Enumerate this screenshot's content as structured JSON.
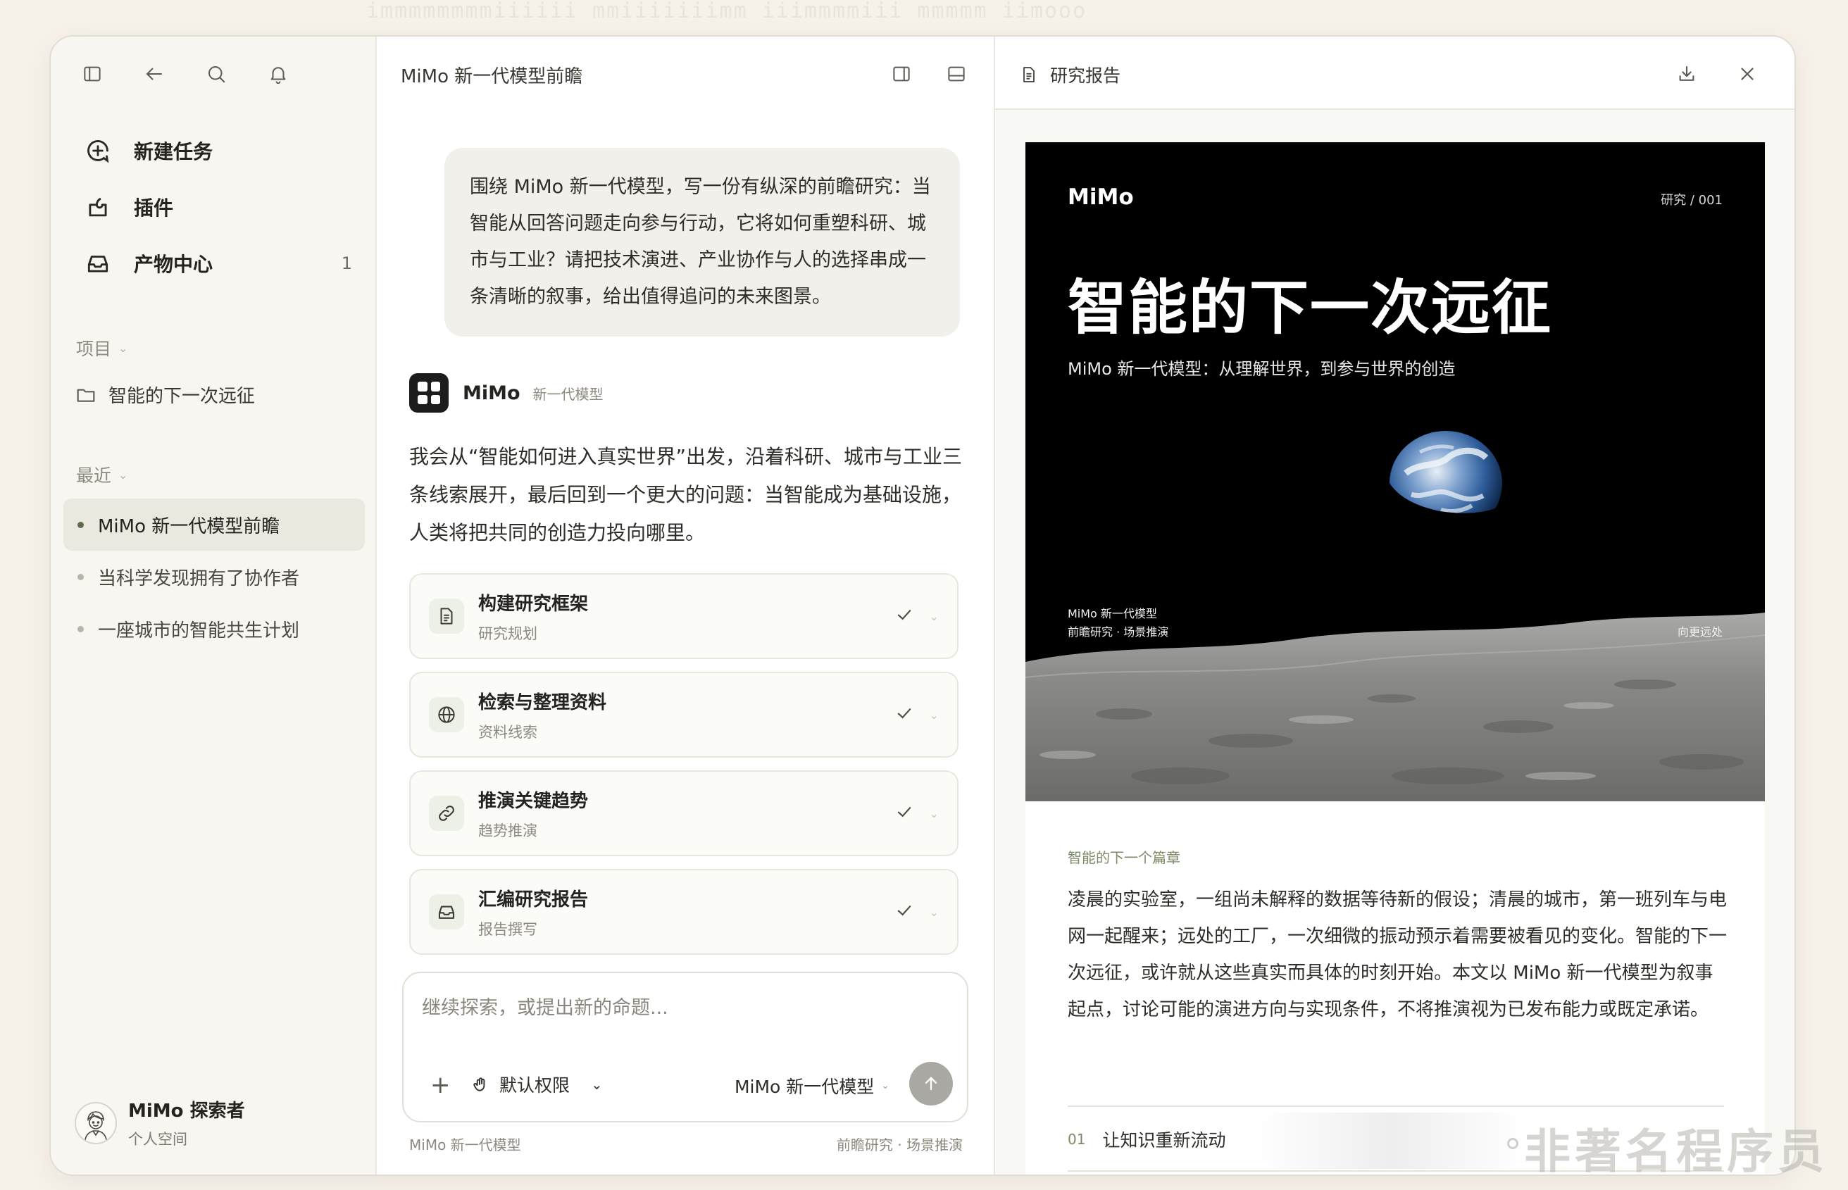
{
  "sidebar": {
    "nav": [
      {
        "label": "新建任务",
        "icon": "new-task-icon"
      },
      {
        "label": "插件",
        "icon": "plugin-icon"
      },
      {
        "label": "产物中心",
        "icon": "inbox-icon",
        "count": "1"
      }
    ],
    "projects_title": "项目",
    "project": "智能的下一次远征",
    "recent_title": "最近",
    "recent": [
      {
        "label": "MiMo 新一代模型前瞻",
        "active": true
      },
      {
        "label": "当科学发现拥有了协作者",
        "active": false
      },
      {
        "label": "一座城市的智能共生计划",
        "active": false
      }
    ],
    "user": {
      "name": "MiMo 探索者",
      "subtitle": "个人空间"
    }
  },
  "chat": {
    "title": "MiMo 新一代模型前瞻",
    "user_message": "围绕 MiMo 新一代模型，写一份有纵深的前瞻研究：当智能从回答问题走向参与行动，它将如何重塑科研、城市与工业？请把技术演进、产业协作与人的选择串成一条清晰的叙事，给出值得追问的未来图景。",
    "assistant_name": "MiMo",
    "assistant_model": "新一代模型",
    "assistant_message": "我会从“智能如何进入真实世界”出发，沿着科研、城市与工业三条线索展开，最后回到一个更大的问题：当智能成为基础设施，人类将把共同的创造力投向哪里。",
    "steps": [
      {
        "title": "构建研究框架",
        "subtitle": "研究规划",
        "icon": "document-icon"
      },
      {
        "title": "检索与整理资料",
        "subtitle": "资料线索",
        "icon": "globe-icon"
      },
      {
        "title": "推演关键趋势",
        "subtitle": "趋势推演",
        "icon": "link-icon"
      },
      {
        "title": "汇编研究报告",
        "subtitle": "报告撰写",
        "icon": "inbox-icon"
      }
    ],
    "composer": {
      "placeholder": "继续探索，或提出新的命题...",
      "permission": "默认权限",
      "model": "MiMo 新一代模型"
    },
    "footer_left": "MiMo 新一代模型",
    "footer_right": "前瞻研究 · 场景推演"
  },
  "report": {
    "panel_title": "研究报告",
    "cover": {
      "brand": "MiMo",
      "code": "研究 / 001",
      "title": "智能的下一次远征",
      "subtitle": "MiMo 新一代模型：从理解世界，到参与世界的创造",
      "meta_line1": "MiMo 新一代模型",
      "meta_line2": "前瞻研究 · 场景推演",
      "meta_right": "向更远处"
    },
    "kicker": "智能的下一个篇章",
    "body": "凌晨的实验室，一组尚未解释的数据等待新的假设；清晨的城市，第一班列车与电网一起醒来；远处的工厂，一次细微的振动预示着需要被看见的变化。智能的下一次远征，或许就从这些真实而具体的时刻开始。本文以 MiMo 新一代模型为叙事起点，讨论可能的演进方向与实现条件，不将推演视为已发布能力或既定承诺。",
    "toc": [
      {
        "num": "01",
        "title": "让知识重新流动"
      }
    ]
  },
  "watermark": "非著名程序员",
  "ghost_text": "immmmmmmmiiiiii mmiiiiiiimm iiimmmmiii mmmmm iimooo"
}
